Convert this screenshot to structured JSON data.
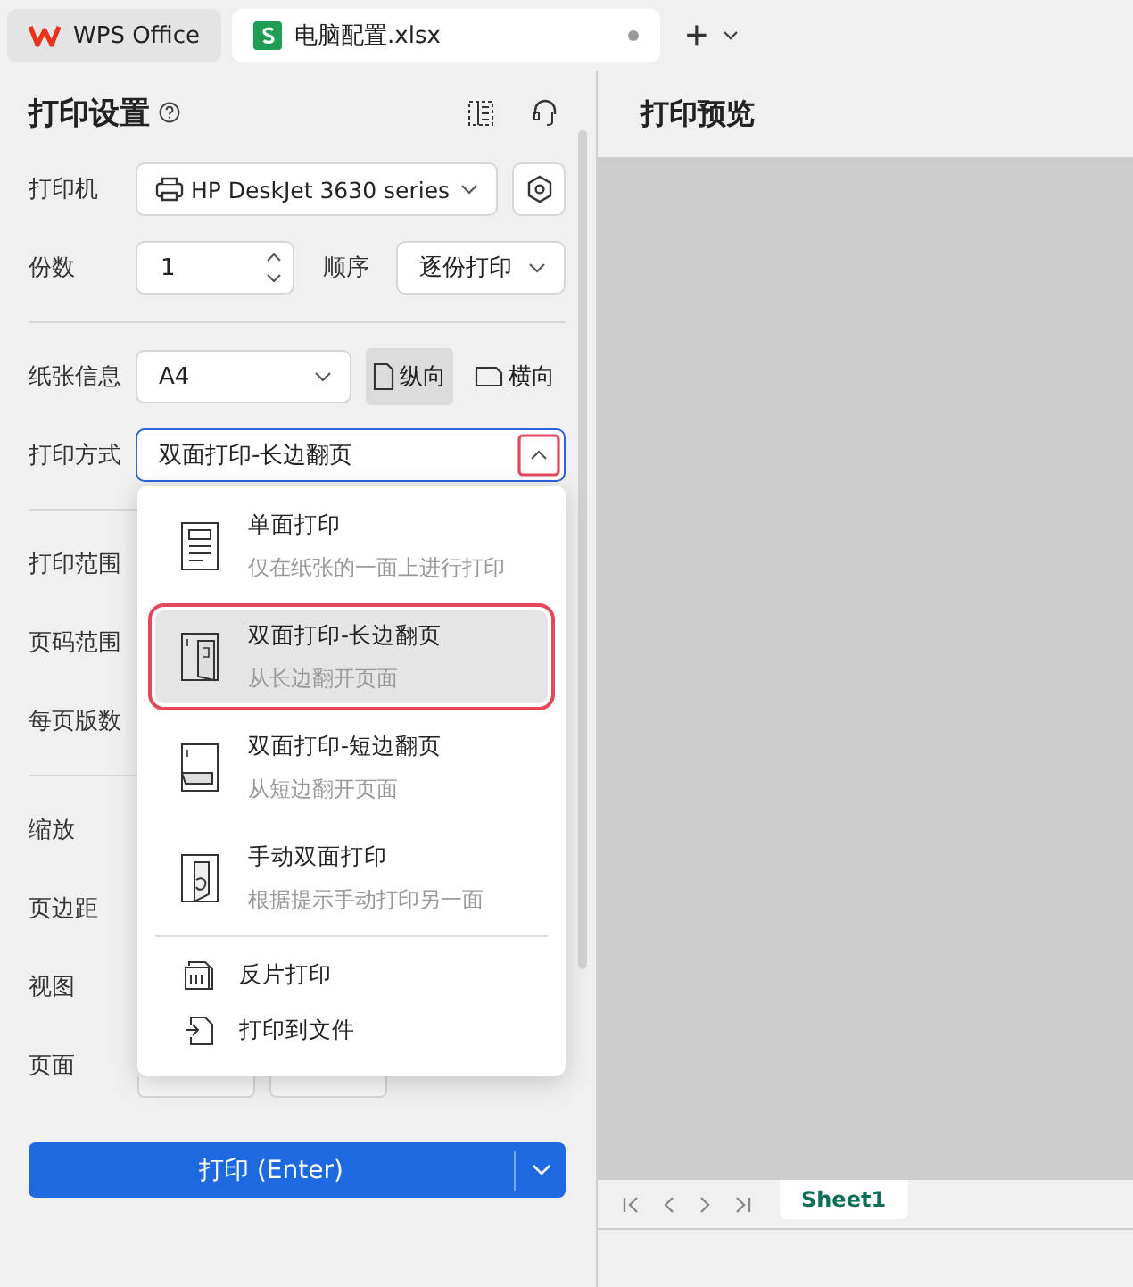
{
  "tabs": [
    {
      "label": "WPS Office",
      "kind": "home",
      "selected": false
    },
    {
      "label": "电脑配置.xlsx",
      "kind": "sheet",
      "selected": true,
      "unsaved": true
    }
  ],
  "new_tab": "+",
  "settings": {
    "title": "打印设置",
    "printer": {
      "label": "打印机",
      "value": "HP DeskJet 3630 series"
    },
    "copies": {
      "label": "份数",
      "value": "1"
    },
    "order": {
      "label": "顺序",
      "value": "逐份打印"
    },
    "paper": {
      "label": "纸张信息",
      "value": "A4"
    },
    "orientation": [
      {
        "label": "纵向",
        "kind": "portrait",
        "selected": true
      },
      {
        "label": "横向",
        "kind": "landscape",
        "selected": false
      }
    ],
    "print_mode": {
      "label": "打印方式",
      "value": "双面打印-长边翻页",
      "expanded": true
    },
    "covered_groups": [
      {
        "rows": [
          "打印范围",
          "页码范围",
          "每页版数"
        ]
      },
      {
        "rows": [
          "缩放",
          "页边距",
          "视图",
          "页面"
        ]
      }
    ],
    "print_button": "打印 (Enter)"
  },
  "mode_menu": {
    "options": [
      {
        "title": "单面打印",
        "subtitle": "仅在纸张的一面上进行打印",
        "kind": "single",
        "selected": false
      },
      {
        "title": "双面打印-长边翻页",
        "subtitle": "从长边翻开页面",
        "kind": "long",
        "selected": true
      },
      {
        "title": "双面打印-短边翻页",
        "subtitle": "从短边翻开页面",
        "kind": "short",
        "selected": false
      },
      {
        "title": "手动双面打印",
        "subtitle": "根据提示手动打印另一面",
        "kind": "manual",
        "selected": false
      }
    ],
    "actions": [
      {
        "label": "反片打印",
        "kind": "mirror"
      },
      {
        "label": "打印到文件",
        "kind": "file"
      }
    ]
  },
  "preview": {
    "title": "打印预览",
    "sheet_tabs": [
      {
        "label": "Sheet1",
        "selected": true
      }
    ]
  }
}
